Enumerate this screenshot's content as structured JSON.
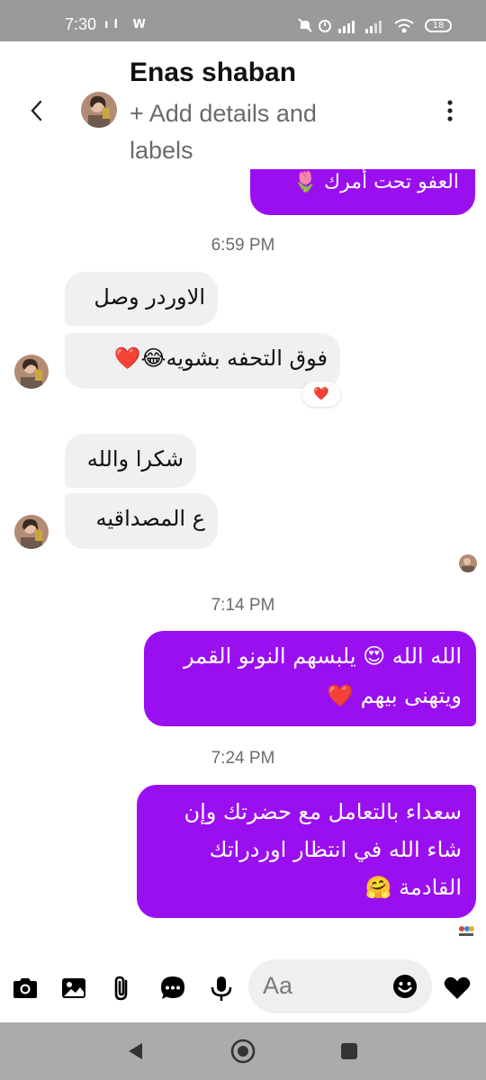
{
  "status_bar": {
    "time": "7:30",
    "left_icons": "ıl W",
    "battery": "18"
  },
  "header": {
    "contact_name": "Enas shaban",
    "subtitle": "+ Add details and labels"
  },
  "messages": {
    "partial_outgoing": "العفو تحت أمرك 🌷",
    "ts1": "6:59 PM",
    "in1": "الاوردر وصل",
    "in2": "فوق التحفه بشويه😂❤️",
    "in2_reaction": "❤️",
    "in3": "شكرا والله",
    "in4": "ع المصداقيه",
    "ts2": "7:14 PM",
    "out1_line1": "الله الله 😍 يلبسهم النونو القمر",
    "out1_line2": "ويتهنى بيهم ❤️",
    "ts3": "7:24 PM",
    "out2_line1": "سعداء بالتعامل مع حضرتك وإن",
    "out2_line2": "شاء الله في انتظار اوردراتك",
    "out2_line3": "القادمة 🤗"
  },
  "composer": {
    "placeholder": "Aa"
  },
  "icons": {
    "camera": "camera-icon",
    "gallery": "image-icon",
    "attach": "paperclip-icon",
    "chat": "chat-bubble-icon",
    "mic": "microphone-icon",
    "emoji": "smiley-icon",
    "like": "heart-icon"
  },
  "colors": {
    "outgoing_bubble": "#9a0ff0",
    "incoming_bubble": "#f0f0f0",
    "statusbar": "#9a9a9a",
    "navbar": "#ababab"
  }
}
